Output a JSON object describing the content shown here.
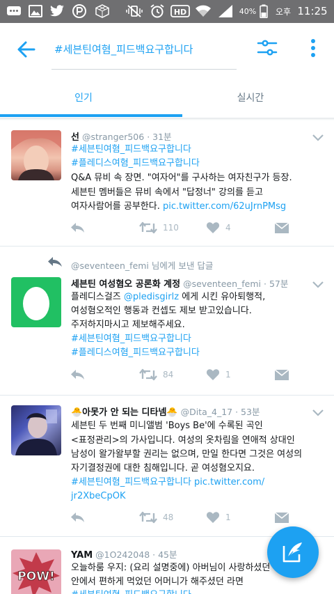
{
  "status_bar": {
    "battery": "40%",
    "ampm": "오후",
    "time": "11:25"
  },
  "header": {
    "search_query": "#세븐틴여혐_피드백요구합니다",
    "tabs": [
      {
        "label": "인기",
        "active": true
      },
      {
        "label": "실시간",
        "active": false
      }
    ]
  },
  "colors": {
    "accent": "#1da1f2",
    "muted": "#8899a6",
    "status_bar": "#6f6f71"
  },
  "tweets": [
    {
      "name": "선",
      "handle": "@stranger506",
      "time": "· 31분",
      "lines": [
        {
          "hashtag": "#세븐틴여혐_피드백요구합니다"
        },
        {
          "hashtag": "#플레디스여혐_피드백요구합니다"
        },
        {
          "text": "Q&A 뮤비 속 장면. \"여자어\"를 구사하는 여자친구가 등장."
        },
        {
          "text": "세븐틴 멤버들은 뮤비 속에서 \"답정너\" 강의를 듣고"
        },
        {
          "text": "여자사람어를 공부한다. ",
          "link": "pic.twitter.com/62uJrnPMsg"
        }
      ],
      "retweets": "110",
      "likes": "4"
    },
    {
      "reply_context": "@seventeen_femi 님에게 보낸 답글",
      "name": "세븐틴 여성혐오 공론화 계정",
      "handle": "@seventeen_femi",
      "time": "· 57분",
      "lines": [
        {
          "text": "플레디스걸즈 ",
          "link": "@pledisgirlz",
          "text2": " 에게 시킨 유아퇴행적,"
        },
        {
          "text": "여성혐오적인 행동과 컨셉도 제보 받고있습니다."
        },
        {
          "text": "주저하지마시고 제보해주세요."
        },
        {
          "hashtag": "#세븐틴여혐_피드백요구합니다"
        },
        {
          "hashtag": "#플레디스여혐_피드백요구합니다"
        }
      ],
      "retweets": "84",
      "likes": "1"
    },
    {
      "name": "🐣아못가 안 되는 디타넴🐣",
      "handle": "@Dita_4_17",
      "time": "· 53분",
      "lines": [
        {
          "text": "세븐틴 두 번째 미니앨범 'Boys Be'에 수록된 곡인"
        },
        {
          "text": "<표정관리>의 가사입니다. 여성의 옷차림을 연애적 상대인"
        },
        {
          "text": "남성이 왈가왈부할 권리는 없으며, 만일 한다면 그것은 여성의"
        },
        {
          "text": "자기결정권에 대한 침해입니다. 곧 여성혐오지요."
        },
        {
          "hashtag": "#세븐틴여혐_피드백요구합니다",
          "link": " pic.twitter.com/"
        },
        {
          "link": "jr2XbeCpOK"
        }
      ],
      "retweets": "48",
      "likes": "1"
    },
    {
      "name": "YAM",
      "handle": "@1O242048",
      "time": "· 45분",
      "lines": [
        {
          "text": "오늘하룸 우지: (요리 설명중에) 아버님이 사랑하셨던 ~ 차"
        },
        {
          "text": "안에서 편하게 먹었던 어머니가 해주셨던 라면"
        },
        {
          "hashtag": "#세븐틴여혐_피드백요구합니다"
        }
      ],
      "avatar_text": "POW!"
    }
  ]
}
